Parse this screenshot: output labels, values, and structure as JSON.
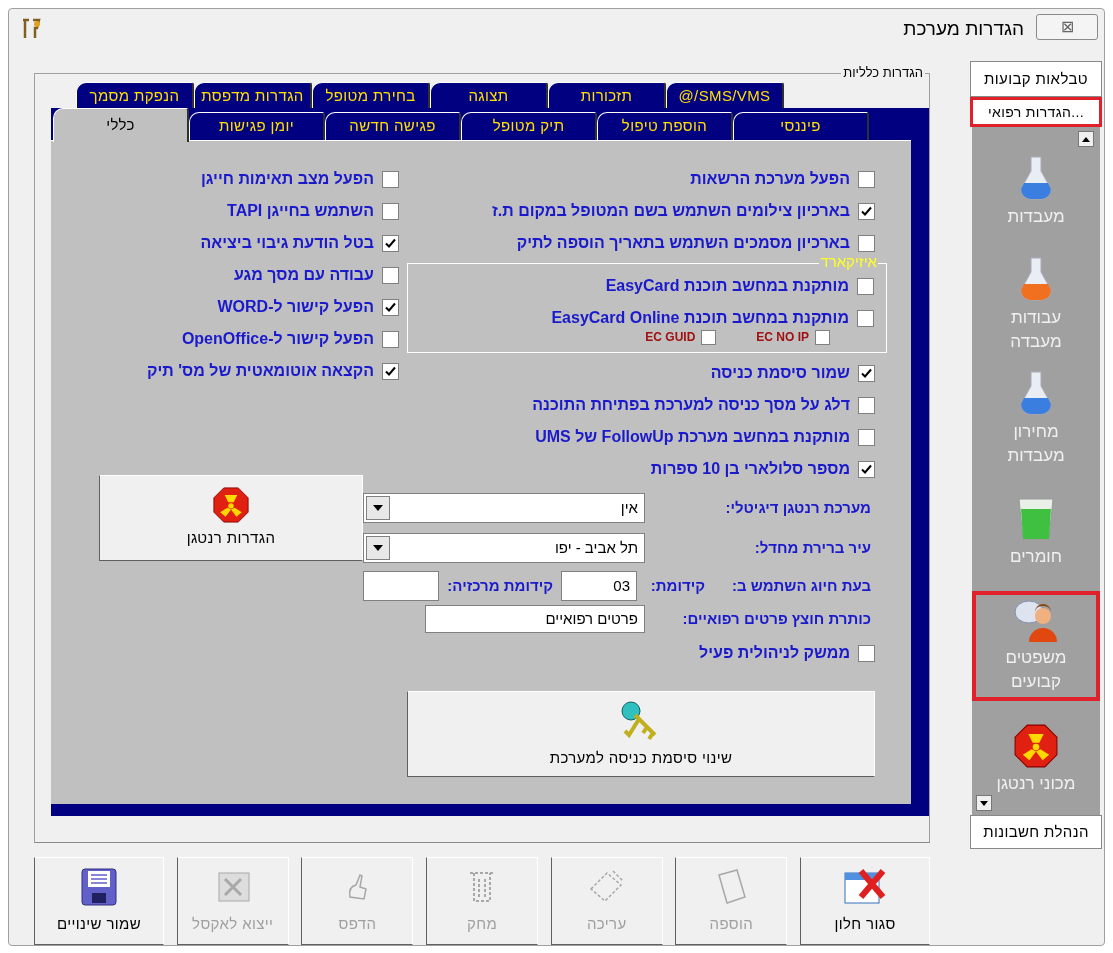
{
  "window": {
    "title": "הגדרות מערכת",
    "close": "⊠"
  },
  "frame_label": "הגדרות כלליות",
  "tab_rows": [
    [
      {
        "label": "SMS/VMS/@",
        "selected": false
      },
      {
        "label": "תזכורות",
        "selected": false
      },
      {
        "label": "תצוגה",
        "selected": false
      },
      {
        "label": "בחירת מטופל",
        "selected": false
      },
      {
        "label": "הגדרות מדפסת",
        "selected": false
      },
      {
        "label": "הנפקת מסמך",
        "selected": false
      }
    ],
    [
      {
        "label": "פיננסי",
        "selected": false
      },
      {
        "label": "הוספת טיפול",
        "selected": false
      },
      {
        "label": "תיק מטופל",
        "selected": false
      },
      {
        "label": "פגישה חדשה",
        "selected": false
      },
      {
        "label": "יומן פגישות",
        "selected": false
      },
      {
        "label": "כללי",
        "selected": true
      }
    ]
  ],
  "right_checks_top": [
    {
      "label": "הפעל מערכת הרשאות",
      "checked": false
    },
    {
      "label": "בארכיון צילומים השתמש בשם המטופל במקום ת.ז",
      "checked": true
    },
    {
      "label": "בארכיון מסמכים השתמש בתאריך הוספה לתיק",
      "checked": false
    }
  ],
  "easycard": {
    "label": "איזיקארד",
    "options": [
      {
        "label": "מותקנת במחשב תוכנת EasyCard",
        "checked": false
      },
      {
        "label": "מותקנת במחשב תוכנת EasyCard Online",
        "checked": false
      }
    ],
    "small_options": [
      {
        "label": "EC NO IP",
        "checked": false
      },
      {
        "label": "EC GUID",
        "checked": false
      }
    ]
  },
  "right_checks_bottom": [
    {
      "label": "שמור סיסמת כניסה",
      "checked": true
    },
    {
      "label": "דלג על מסך כניסה למערכת בפתיחת התוכנה",
      "checked": false
    },
    {
      "label": "מותקנת במחשב מערכת FollowUp של UMS",
      "checked": false
    },
    {
      "label": "מספר סלולארי בן 10 ספרות",
      "checked": true
    }
  ],
  "left_checks": [
    {
      "label": "הפעל מצב תאימות חייגן",
      "checked": false
    },
    {
      "label": "השתמש בחייגן TAPI",
      "checked": false
    },
    {
      "label": "בטל הודעת גיבוי ביציאה",
      "checked": true
    },
    {
      "label": "עבודה עם מסך מגע",
      "checked": false
    },
    {
      "label": "הפעל קישור ל-WORD",
      "checked": true
    },
    {
      "label": "הפעל קישור ל-OpenOffice",
      "checked": false
    },
    {
      "label": "הקצאה אוטומאטית של מס' תיק",
      "checked": true
    }
  ],
  "combos": [
    {
      "label": "מערכת רנטגן דיגיטלי:",
      "value": "אין"
    },
    {
      "label": "עיר ברירת מחדל:",
      "value": "תל אביב - יפו"
    }
  ],
  "xray_button": "הגדרות רנטגן",
  "dial": {
    "label": "בעת חיוג השתמש ב:",
    "prefix_label": "קידומת:",
    "prefix": "03",
    "central_label": "קידומת מרכזיה:"
  },
  "tab_title": {
    "label": "כותרת חוצץ פרטים רפואיים:",
    "value": "פרטים רפואיים"
  },
  "interface_check": {
    "label": "ממשק לניהולית פעיל",
    "checked": false
  },
  "password_button": "שינוי סיסמת כניסה למערכת",
  "sidebar": {
    "top": "טבלאות קבועות",
    "current": {
      "label": "...הגדרות רפואי",
      "highlighted": true
    },
    "items": [
      {
        "label": "מעבדות",
        "kind": "flask_blue",
        "highlighted": false
      },
      {
        "label": "עבודות מעבדה",
        "kind": "flask_orange",
        "highlighted": false
      },
      {
        "label": "מחירון מעבדות",
        "kind": "flask_blue",
        "highlighted": false
      },
      {
        "label": "חומרים",
        "kind": "beaker",
        "highlighted": false
      },
      {
        "label": "משפטים קבועים",
        "kind": "person",
        "highlighted": true
      },
      {
        "label": "מכוני רנטגן",
        "kind": "radiation",
        "highlighted": false
      }
    ],
    "bottom": "הנהלת חשבונות"
  },
  "buttons": [
    {
      "label": "סגור חלון",
      "kind": "close",
      "disabled": false
    },
    {
      "label": "הוספה",
      "kind": "page",
      "disabled": true
    },
    {
      "label": "עריכה",
      "kind": "edit",
      "disabled": true
    },
    {
      "label": "מחק",
      "kind": "trash",
      "disabled": true
    },
    {
      "label": "הדפס",
      "kind": "print",
      "disabled": true
    },
    {
      "label": "ייצוא לאקסל",
      "kind": "excel",
      "disabled": true
    },
    {
      "label": "שמור שינויים",
      "kind": "save",
      "disabled": false
    }
  ]
}
